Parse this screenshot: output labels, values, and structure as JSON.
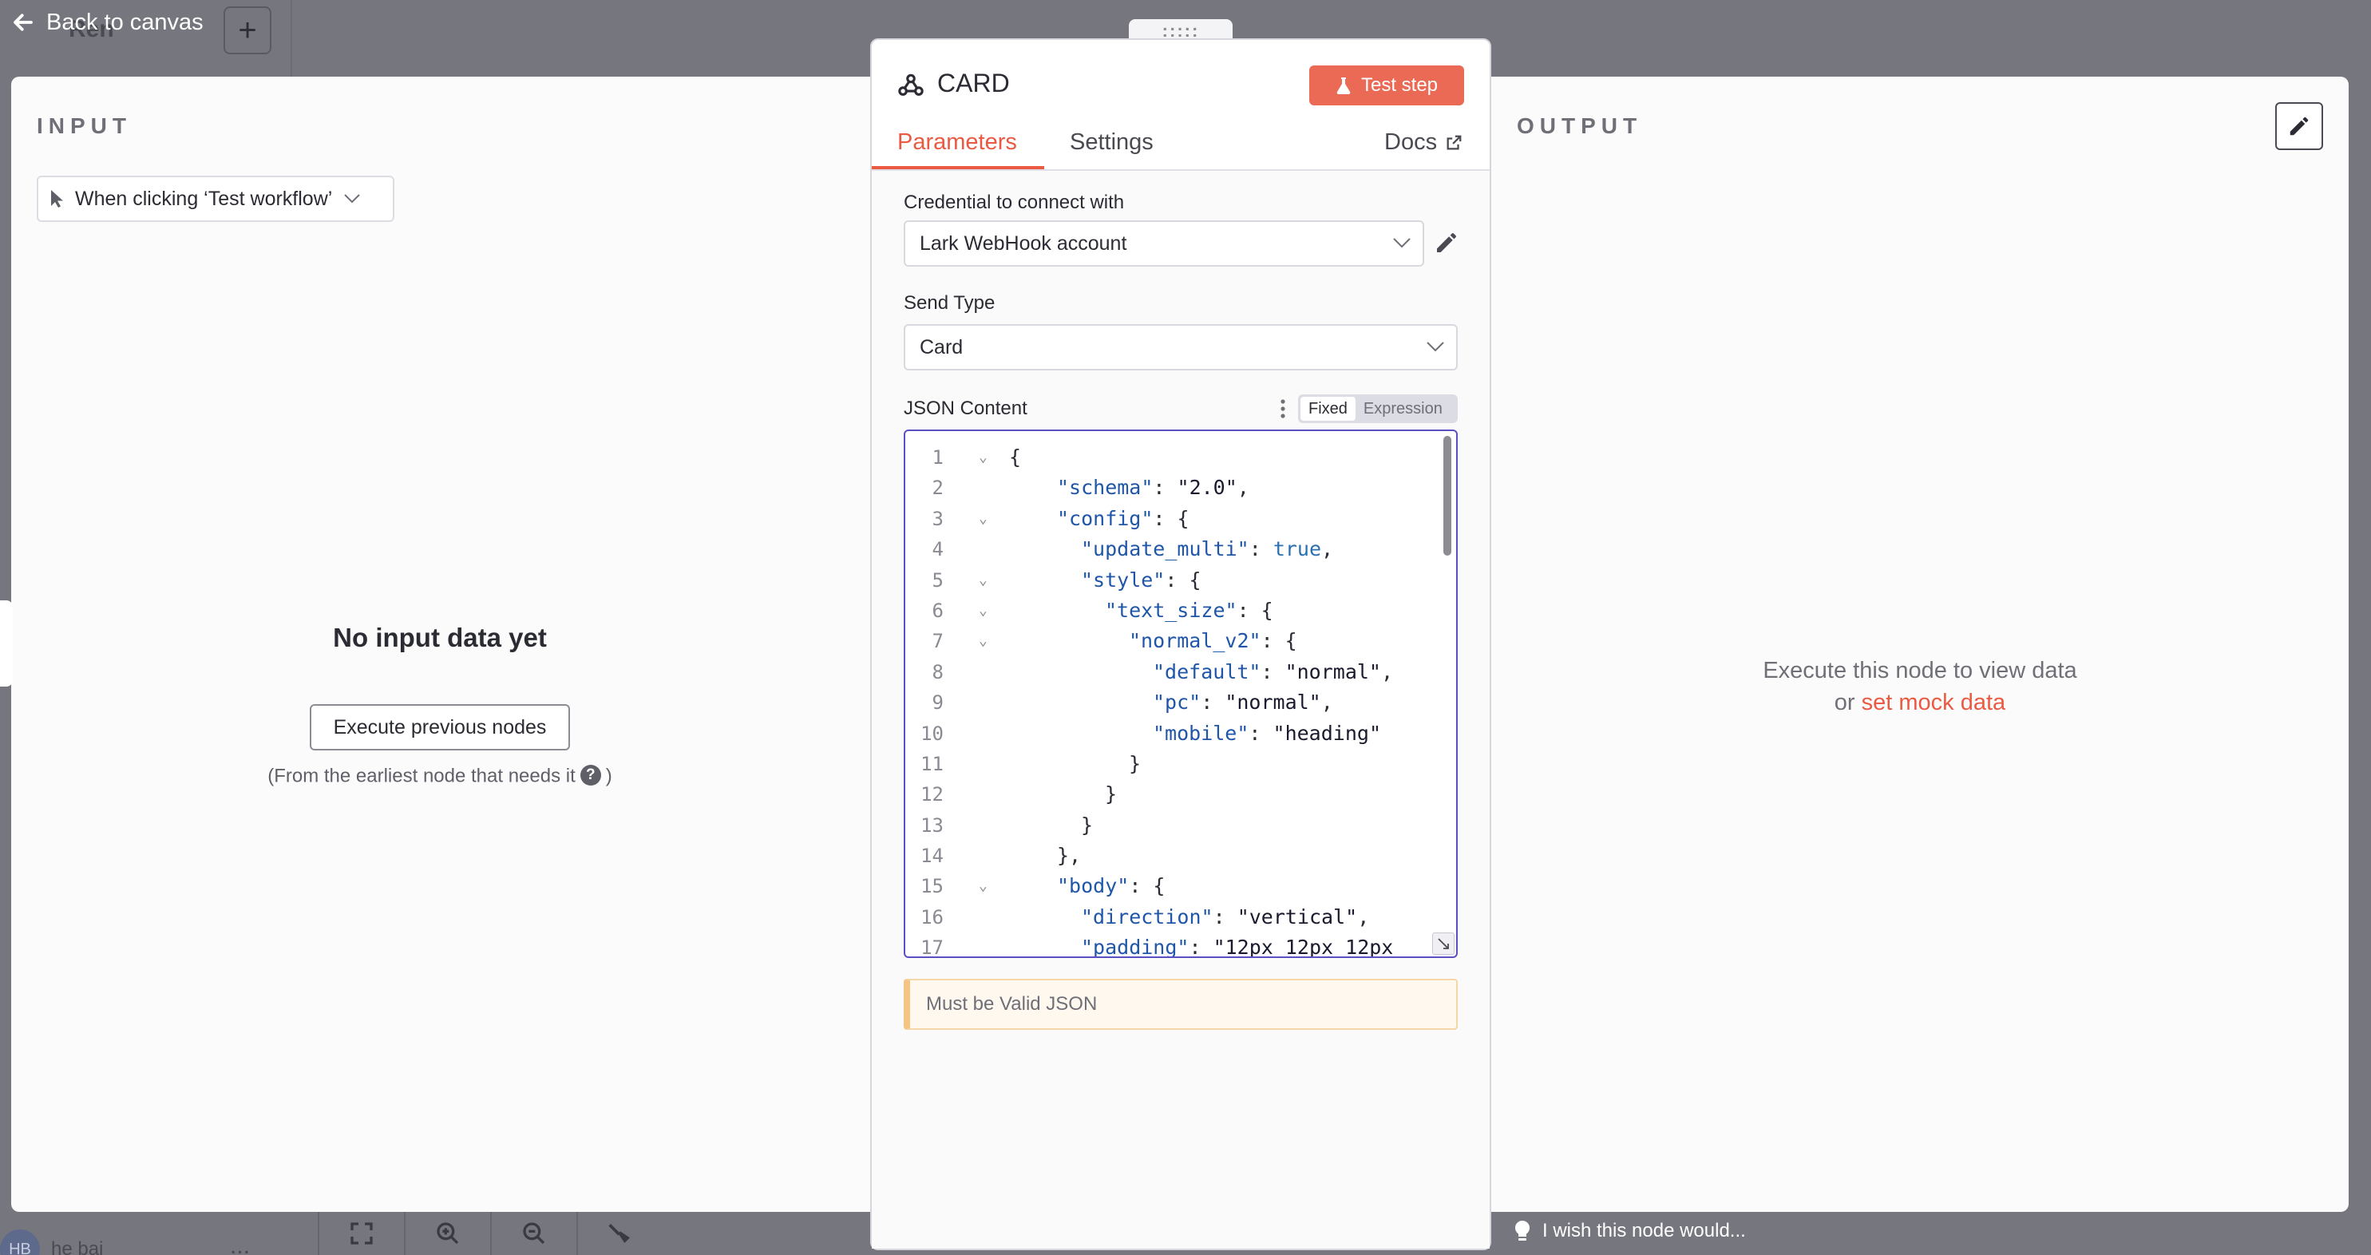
{
  "topbar": {
    "back_label": "Back to canvas",
    "workflow_name": "Ren",
    "add_label": "+"
  },
  "input_panel": {
    "title": "INPUT",
    "trigger_select": "When clicking ‘Test workflow’",
    "empty_title": "No input data yet",
    "execute_previous_label": "Execute previous nodes",
    "note_before": "(From the earliest node that needs it",
    "help_glyph": "?",
    "note_after": ")"
  },
  "output_panel": {
    "title": "OUTPUT",
    "exec_line1": "Execute this node to view data",
    "exec_or": "or",
    "mock_link": "set mock data",
    "feedback": "I wish this node would..."
  },
  "node": {
    "drag_handle": ":::::",
    "title": "CARD",
    "test_step_label": "Test step",
    "tabs": {
      "parameters": "Parameters",
      "settings": "Settings",
      "docs": "Docs"
    },
    "credential_label": "Credential to connect with",
    "credential_value": "Lark WebHook account",
    "send_type_label": "Send Type",
    "send_type_value": "Card",
    "json_label": "JSON Content",
    "mode_fixed": "Fixed",
    "mode_expression": "Expression",
    "json_lines": [
      {
        "n": "1",
        "fold": true,
        "indent": 0,
        "parts": [
          [
            "p",
            "{"
          ]
        ]
      },
      {
        "n": "2",
        "fold": false,
        "indent": 2,
        "parts": [
          [
            "k",
            "\"schema\""
          ],
          [
            "p",
            ": "
          ],
          [
            "s",
            "\"2.0\""
          ],
          [
            "p",
            ","
          ]
        ]
      },
      {
        "n": "3",
        "fold": true,
        "indent": 2,
        "parts": [
          [
            "k",
            "\"config\""
          ],
          [
            "p",
            ": {"
          ]
        ]
      },
      {
        "n": "4",
        "fold": false,
        "indent": 3,
        "parts": [
          [
            "k",
            "\"update_multi\""
          ],
          [
            "p",
            ": "
          ],
          [
            "b",
            "true"
          ],
          [
            "p",
            ","
          ]
        ]
      },
      {
        "n": "5",
        "fold": true,
        "indent": 3,
        "parts": [
          [
            "k",
            "\"style\""
          ],
          [
            "p",
            ": {"
          ]
        ]
      },
      {
        "n": "6",
        "fold": true,
        "indent": 4,
        "parts": [
          [
            "k",
            "\"text_size\""
          ],
          [
            "p",
            ": {"
          ]
        ]
      },
      {
        "n": "7",
        "fold": true,
        "indent": 5,
        "parts": [
          [
            "k",
            "\"normal_v2\""
          ],
          [
            "p",
            ": {"
          ]
        ]
      },
      {
        "n": "8",
        "fold": false,
        "indent": 6,
        "parts": [
          [
            "k",
            "\"default\""
          ],
          [
            "p",
            ": "
          ],
          [
            "s",
            "\"normal\""
          ],
          [
            "p",
            ","
          ]
        ]
      },
      {
        "n": "9",
        "fold": false,
        "indent": 6,
        "parts": [
          [
            "k",
            "\"pc\""
          ],
          [
            "p",
            ": "
          ],
          [
            "s",
            "\"normal\""
          ],
          [
            "p",
            ","
          ]
        ]
      },
      {
        "n": "10",
        "fold": false,
        "indent": 6,
        "parts": [
          [
            "k",
            "\"mobile\""
          ],
          [
            "p",
            ": "
          ],
          [
            "s",
            "\"heading\""
          ]
        ]
      },
      {
        "n": "11",
        "fold": false,
        "indent": 5,
        "parts": [
          [
            "p",
            "}"
          ]
        ]
      },
      {
        "n": "12",
        "fold": false,
        "indent": 4,
        "parts": [
          [
            "p",
            "}"
          ]
        ]
      },
      {
        "n": "13",
        "fold": false,
        "indent": 3,
        "parts": [
          [
            "p",
            "}"
          ]
        ]
      },
      {
        "n": "14",
        "fold": false,
        "indent": 2,
        "parts": [
          [
            "p",
            "},"
          ]
        ]
      },
      {
        "n": "15",
        "fold": true,
        "indent": 2,
        "parts": [
          [
            "k",
            "\"body\""
          ],
          [
            "p",
            ": {"
          ]
        ]
      },
      {
        "n": "16",
        "fold": false,
        "indent": 3,
        "parts": [
          [
            "k",
            "\"direction\""
          ],
          [
            "p",
            ": "
          ],
          [
            "s",
            "\"vertical\""
          ],
          [
            "p",
            ","
          ]
        ]
      },
      {
        "n": "17",
        "fold": false,
        "indent": 3,
        "parts": [
          [
            "k",
            "\"padding\""
          ],
          [
            "p",
            ": "
          ],
          [
            "s",
            "\"12px 12px 12px"
          ]
        ]
      }
    ],
    "validation_message": "Must be Valid JSON"
  },
  "bottom": {
    "user_initials": "HB",
    "user_name": "he bai",
    "more_label": "..."
  },
  "colors": {
    "accent": "#ea5a43",
    "code_border": "#5b50c2",
    "backdrop": "#76767e"
  }
}
